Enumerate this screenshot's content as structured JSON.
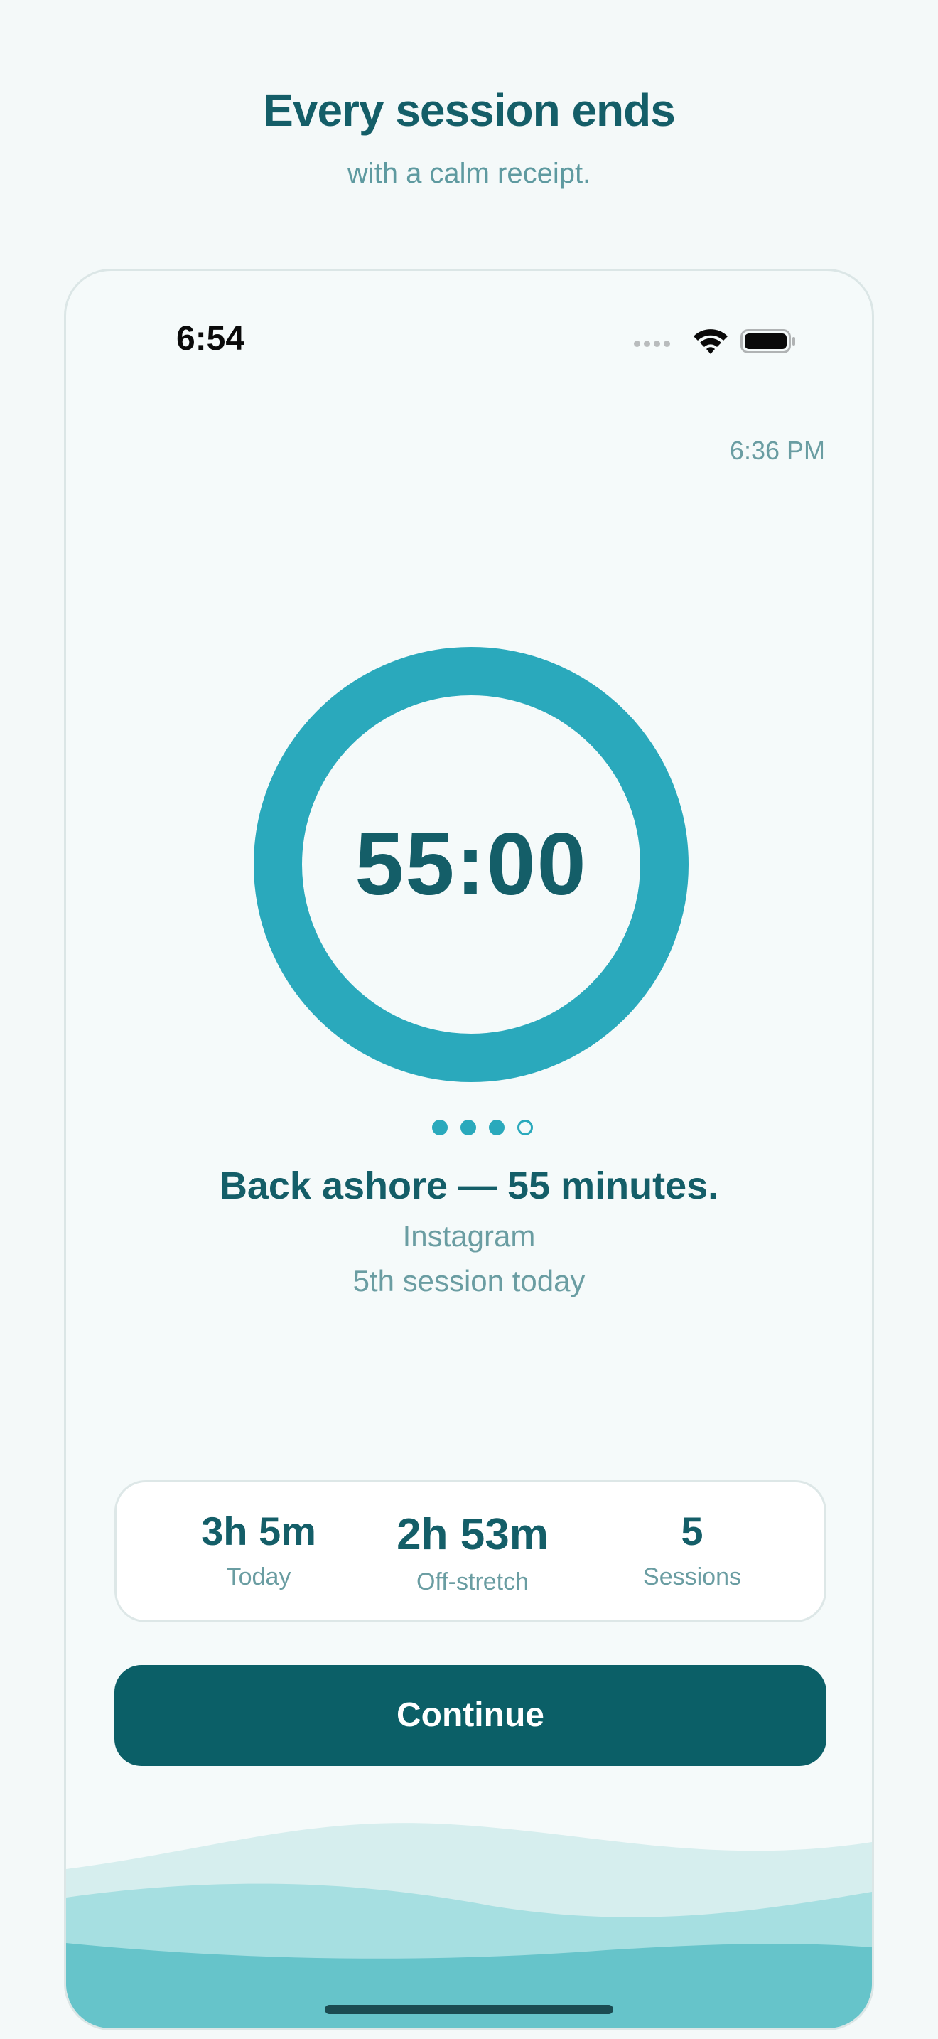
{
  "headline": {
    "title": "Every session ends",
    "subtitle": "with a calm receipt."
  },
  "status_bar": {
    "time": "6:54",
    "icons": [
      "signal-dots-icon",
      "wifi-icon",
      "battery-icon"
    ]
  },
  "clock": {
    "time": "6:36 PM"
  },
  "timer": {
    "display": "55:00",
    "progress": 1.0
  },
  "pager": {
    "total": 4,
    "filled": 3
  },
  "summary": {
    "message": "Back ashore — 55 minutes.",
    "app": "Instagram",
    "session_note": "5th session today"
  },
  "stats": [
    {
      "value": "3h 5m",
      "label": "Today"
    },
    {
      "value": "2h 53m",
      "label": "Off-stretch"
    },
    {
      "value": "5",
      "label": "Sessions"
    }
  ],
  "actions": {
    "continue_label": "Continue"
  },
  "colors": {
    "background": "#f4f9f9",
    "primary_dark": "#145e68",
    "button": "#0b5f67",
    "ring": "#2aa9bc",
    "muted_text": "#6a9da2",
    "wave_light": "#d6eeee",
    "wave_mid": "#a6dfe1",
    "wave_deep": "#66c4ca"
  }
}
